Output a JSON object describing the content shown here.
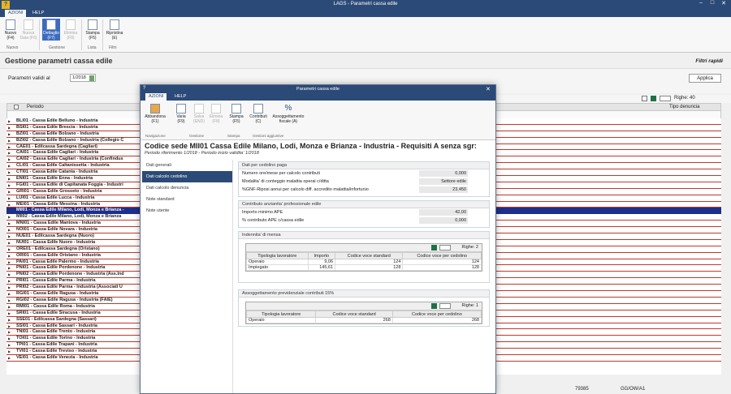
{
  "window": {
    "title": "LAGS - Parametri cassa edile"
  },
  "ribbon_tabs": [
    "AZIONI",
    "HELP"
  ],
  "ribbon": {
    "buttons": [
      {
        "label": "Nuovo\n(F4)",
        "icon": "new-icon"
      },
      {
        "label": "Nuova\nData (F6)",
        "icon": "new-date-icon"
      },
      {
        "label": "Dettaglio\n(F7)",
        "icon": "detail-icon"
      },
      {
        "label": "Elimina\n(F8)",
        "icon": "delete-icon"
      },
      {
        "label": "Stampa\n(F5)",
        "icon": "print-icon"
      },
      {
        "label": "Ripristina\n(E)",
        "icon": "filter-icon"
      }
    ],
    "groups": [
      "Nuovo",
      "Gestione",
      "Lista",
      "Filtri"
    ]
  },
  "page": {
    "title": "Gestione parametri cassa edile",
    "quick_filters": "Filtri rapidi",
    "param_label": "Parametri validi al",
    "param_date": "1/2018",
    "apply": "Applica"
  },
  "grid": {
    "rows_label": "Righe: 40",
    "col_periodo": "Periodo",
    "col_tipo": "Tipo denuncia",
    "rows": [
      "BLI01 - Cassa Edile Belluno - Industria",
      "BSI01 - Cassa Edile Brescia - Industria",
      "BZI01 - Cassa Edile Bolzano - Industria",
      "BZI02 - Cassa Edile Bolzano - Industria (Collegio C",
      "CAE01 - Edilcassa Sardegna (Cagliari)",
      "CAI01 - Cassa Edile Cagliari - Industria",
      "CAI02 - Cassa Edile Cagliari - Industria (Confindus",
      "CLI01 - Cassa Edile Caltanissetta - Industria",
      "CTI01 - Cassa Edile Catania - Industria",
      "ENI01 - Cassa Edile Enna - Industria",
      "FGI01 - Cassa Edile di Capitanata Foggia - Industri",
      "GRI01 - Cassa Edile Grosseto - Industria",
      "LUI01 - Cassa Edile Lucca - Industria",
      "MEI01 - Cassa Edile Messina - Industria",
      "MII01 - Cassa Edile Milano, Lodi, Monza e Brianza -",
      "MII02 - Cassa Edile Milano, Lodi, Monza e Brianza",
      "MNI01 - Cassa Edile Mantova - Industria",
      "NOI01 - Cassa Edile Novara - Industria",
      "NUE01 - Edilcassa Sardegna (Nuoro)",
      "NUI01 - Cassa Edile Nuoro - Industria",
      "ORE01 - Edilcassa Sardegna (Oristano)",
      "ORI01 - Cassa Edile Oristano - Industria",
      "PAI01 - Cassa Edile Palermo - Industria",
      "PNI01 - Cassa Edile Pordenone - Industria",
      "PNI02 - Cassa Edile Pordenone - Industria (Ass.Ind",
      "PRI01 - Cassa Edile Parma - Industria",
      "PRI02 - Cassa Edile Parma - Industria (Associati U",
      "RGI01 - Cassa Edile Ragusa - Industria",
      "RGI02 - Cassa Edile Ragusa - Industria (FAIE)",
      "RMI01 - Cassa Edile Roma - Industria",
      "SRI01 - Cassa Edile Siracusa - Industria",
      "SSE01 - Edilcassa Sardegna (Sassari)",
      "SSI01 - Cassa Edile Sassari - Industria",
      "TNI01 - Cassa Edile Trento - Industria",
      "TOI01 - Cassa Edile Torino - Industria",
      "TPI01 - Cassa Edile Trapani - Industria",
      "TVI01 - Cassa Edile Treviso - Industria",
      "VEI01 - Cassa Edile Venezia - Industria"
    ],
    "selected_index": 14
  },
  "status": {
    "left": "79385",
    "right": "GG/OW/A1"
  },
  "modal": {
    "title": "Parametri cassa edile",
    "tabs": [
      "AZIONI",
      "HELP"
    ],
    "buttons": [
      {
        "label": "Abbandona\n(F1)"
      },
      {
        "label": "Varia\n(F9)"
      },
      {
        "label": "Salva\n(END)"
      },
      {
        "label": "Elimina\n(F8)"
      },
      {
        "label": "Stampa\n(F5)"
      },
      {
        "label": "Contributi\n(C)"
      },
      {
        "label": "Assoggettamento\nfiscale (A)"
      }
    ],
    "groups": [
      "Navigazione",
      "Gestione",
      "Stampa",
      "Gestioni aggiuntive"
    ],
    "header": "Codice sede MII01 Cassa Edile Milano, Lodi, Monza e Brianza - Industria - Requisiti A senza sgr:",
    "subheader": "Periodo riferimento 1/2018 - Periodo inizio validita' 1/2018",
    "nav": [
      "Dati generali",
      "Dati calcolo cedolino",
      "Dati calcolo denuncia",
      "Note standard",
      "Note utente"
    ],
    "nav_selected": 1,
    "sect1": {
      "title": "Dati per cedolino paga",
      "rows": [
        {
          "label": "Numero ore/mese per calcolo contributi",
          "value": "0,000"
        },
        {
          "label": "Modalita' di conteggio malattia operai c/ditta",
          "value": "Settore edile"
        },
        {
          "label": "%GNF-Riposi annui per calcolo diff. accredito malattia/infortunio",
          "value": "23,450"
        }
      ]
    },
    "sect2": {
      "title": "Contributo anzianita' professionale edile",
      "rows": [
        {
          "label": "Importo minimo APE",
          "value": "42,00"
        },
        {
          "label": "% contributo APE c/cassa edile",
          "value": "0,000"
        }
      ]
    },
    "sect3": {
      "title": "Indennita' di mensa",
      "rows_label": "Righe: 2",
      "headers": [
        "Tipologia lavoratore",
        "Importo",
        "Codice voce standard",
        "Codice voce per cedolino"
      ],
      "rows": [
        [
          "Operaio",
          "9,06",
          "124",
          "124"
        ],
        [
          "Impiegato",
          "145,61",
          "128",
          "128"
        ]
      ]
    },
    "sect4": {
      "title": "Assoggettamento previdenziale contributi 15%",
      "rows_label": "Righe: 1",
      "headers": [
        "Tipologia lavoratore",
        "Codice voce standard",
        "Codice voce per cedolino"
      ],
      "rows": [
        [
          "Operaio",
          "268",
          "268"
        ]
      ]
    }
  }
}
